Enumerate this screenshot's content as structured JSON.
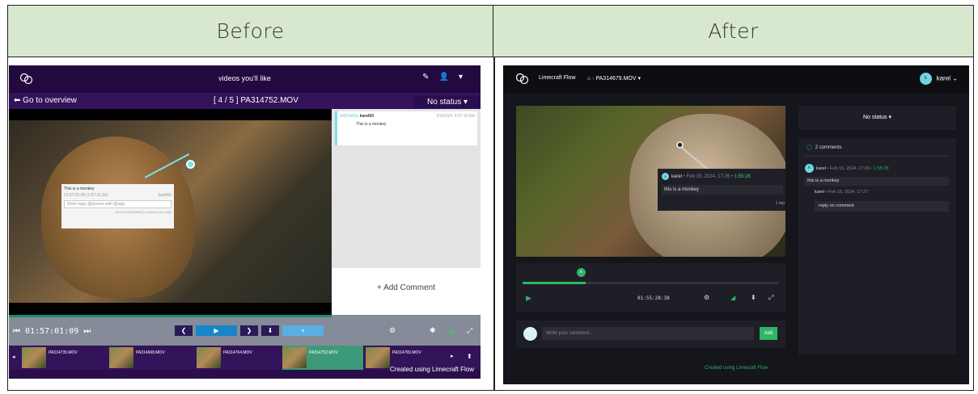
{
  "headers": {
    "before": "Before",
    "after": "After"
  },
  "before": {
    "page_title": "videos you'll like",
    "back_link": "Go to overview",
    "clip_position": "[ 4 / 5 ] PA314752.MOV",
    "status": "No status",
    "comment_card": {
      "time": "1h57m01s",
      "user": "karel60",
      "date": "3/4/2024, 9:07:39 AM",
      "text": "This is a monkey"
    },
    "popup": {
      "text": "This is a monkey",
      "sub": "01:57:01:09 (1:57:21.6h)",
      "by": "karel60",
      "input_placeholder": "Write reply @person with @tags",
      "hint": "press [Shift+Enter] to submit your reply"
    },
    "add_comment": "+ Add Comment",
    "timecode": "01:57:01:09",
    "thumbnails": [
      "PA314735.MOV",
      "PA314668.MOV",
      "PA314764.MOV",
      "PA314752.MOV",
      "PA314765.MOV"
    ],
    "credit": "Created using Limecraft Flow"
  },
  "after": {
    "brand": "Limecraft Flow",
    "breadcrumb_file": "PA314679.MOV",
    "user": "karel",
    "avatar_letter": "k",
    "status": "No status",
    "popup": {
      "user": "karel",
      "date": "Feb 15, 2024, 17:26",
      "time": "1:55:28",
      "text": "this is a monkey",
      "reply_hint": "1 rep"
    },
    "timecode": "01:55:28:38",
    "comment_placeholder": "Write your comment...",
    "add_label": "Add",
    "comment_count": "2 comments",
    "comment": {
      "user": "karel",
      "date": "Feb 15, 2024, 17:26",
      "time": "1:55:28",
      "text": "this is a monkey"
    },
    "reply": {
      "user": "karel",
      "date": "Feb 15, 2024, 17:27",
      "text": "reply on comment"
    },
    "credit": "Created using Limecraft Flow",
    "accent": "#2fb563"
  }
}
